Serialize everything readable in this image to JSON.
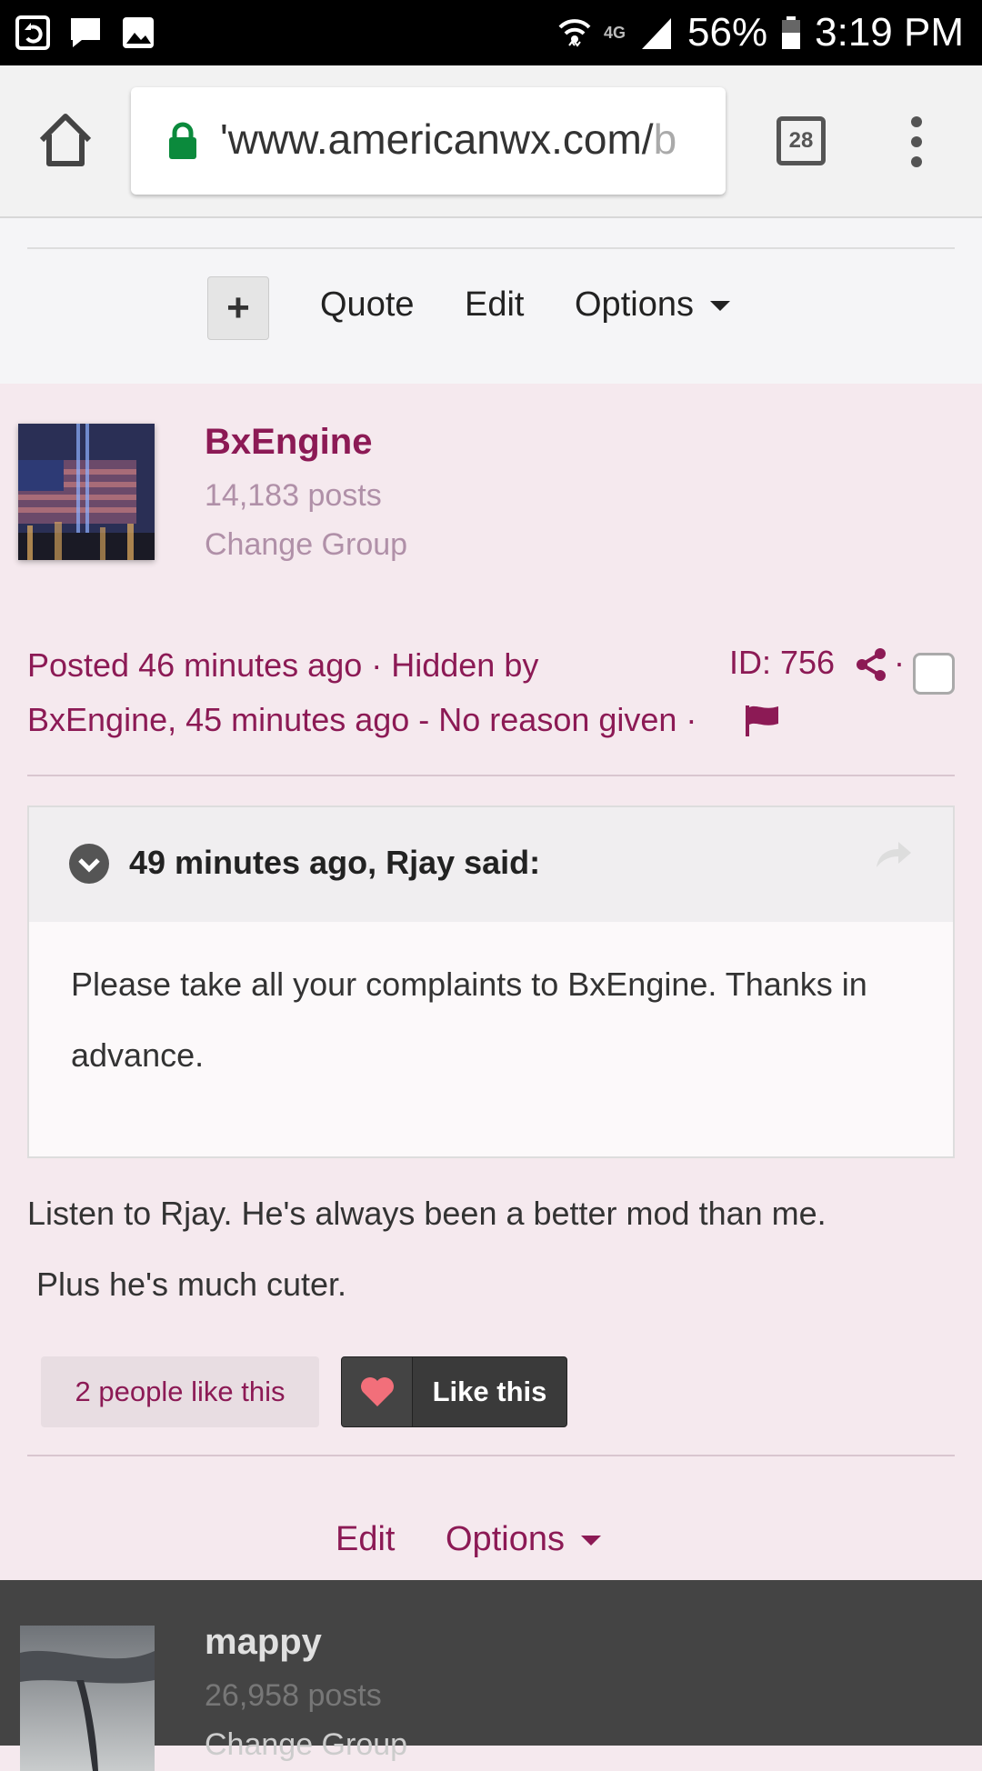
{
  "status_bar": {
    "network": "4G",
    "battery": "56%",
    "time": "3:19 PM"
  },
  "browser": {
    "url_main": "'www.americanwx.com/",
    "url_fade": "b",
    "tab_count": "28"
  },
  "prev_post_actions": {
    "quote": "Quote",
    "edit": "Edit",
    "options": "Options"
  },
  "post": {
    "author": {
      "name": "BxEngine",
      "posts": "14,183 posts",
      "group": "Change Group"
    },
    "meta_line1": "Posted 46 minutes ago · Hidden by",
    "meta_line2": "BxEngine, 45 minutes ago - No reason given ·",
    "post_id": "ID: 756",
    "dot": "·",
    "quote": {
      "title": "49 minutes ago, Rjay said:",
      "body": "Please take all your complaints to BxEngine.   Thanks in advance."
    },
    "body_line1": "Listen to Rjay.  He's always been a better mod than me.",
    "body_line2": " Plus he's much cuter.",
    "likes_count": "2 people like this",
    "like_button": "Like this",
    "edit": "Edit",
    "options": "Options"
  },
  "next_post": {
    "name": "mappy",
    "posts": "26,958 posts",
    "group": "Change Group"
  },
  "colors": {
    "accent": "#8c1a55",
    "post_bg": "#f5e9ee",
    "next_bg": "#444444"
  }
}
